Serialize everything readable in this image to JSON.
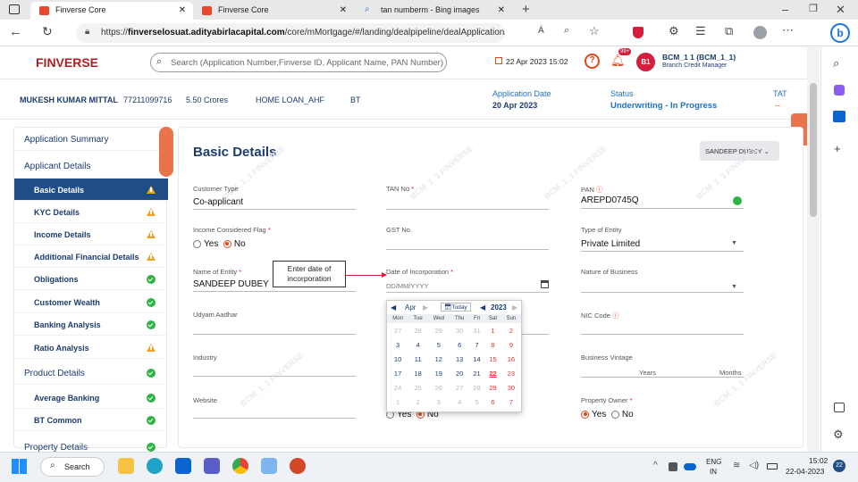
{
  "browser": {
    "tabs": [
      {
        "label": "Finverse Core"
      },
      {
        "label": "Finverse Core"
      },
      {
        "label": "tan numberm - Bing images"
      }
    ],
    "url_prefix": "https://",
    "url_host": "finverselosuat.adityabirlacapital.com",
    "url_path": "/core/mMortgage/#/landing/dealpipeline/dealApplication/perso...",
    "reader_label": "Á",
    "profile_icon": "profile-avatar"
  },
  "app": {
    "logo_text": "FINVERSE",
    "search_placeholder": "Search (Application Number,Finverse ID, Applicant Name, PAN Number)",
    "datetime": "22 Apr 2023 15:02",
    "notif_badge": "99+",
    "user_initials": "B1",
    "user_name": "BCM_1 1 (BCM_1_1)",
    "user_role": "Branch Credit Manager"
  },
  "infobar": {
    "name": "MUKESH KUMAR MITTAL",
    "phone": "77211099716",
    "amount": "5.50 Crores",
    "product": "HOME LOAN_AHF",
    "type": "BT",
    "app_date_label": "Application Date",
    "app_date": "20 Apr 2023",
    "status_label": "Status",
    "status": "Underwriting - In Progress",
    "tat_label": "TAT",
    "tat": "--"
  },
  "sidebar": {
    "sections": [
      {
        "label": "Application Summary"
      },
      {
        "label": "Applicant Details"
      }
    ],
    "items": [
      {
        "label": "Basic Details",
        "status": "warn"
      },
      {
        "label": "KYC Details",
        "status": "warn"
      },
      {
        "label": "Income Details",
        "status": "warn"
      },
      {
        "label": "Additional Financial Details",
        "status": "warn"
      },
      {
        "label": "Obligations",
        "status": "ok"
      },
      {
        "label": "Customer Wealth",
        "status": "ok"
      },
      {
        "label": "Banking Analysis",
        "status": "ok"
      },
      {
        "label": "Ratio Analysis",
        "status": "warn"
      }
    ],
    "product_section": "Product Details",
    "product_items": [
      {
        "label": "Average Banking",
        "status": "ok"
      },
      {
        "label": "BT Common",
        "status": "ok"
      }
    ],
    "property_section": "Property Details"
  },
  "form": {
    "title": "Basic Details",
    "user_dropdown": "SANDEEP DUBEY",
    "customer_type_label": "Customer Type",
    "customer_type": "Co-applicant",
    "tan_label": "TAN No",
    "pan_label": "PAN",
    "pan": "AREPD0745Q",
    "income_flag_label": "Income Considered Flag",
    "yes": "Yes",
    "no": "No",
    "gst_label": "GST No.",
    "entity_type_label": "Type of Entity",
    "entity_type": "Private Limited",
    "entity_name_label": "Name of Entity",
    "entity_name": "SANDEEP DUBEY",
    "doi_label": "Date of Incorporation",
    "doi_placeholder": "DD/MM/YYYY",
    "nature_label": "Nature of Business",
    "udyam_label": "Udyam Aadhar",
    "nic_label": "NIC Code",
    "industry_label": "Industry",
    "vintage_label": "Business Vintage",
    "years": "Years",
    "months": "Months",
    "website_label": "Website",
    "owner_label": "Property Owner",
    "callout": "Enter date of incorporation",
    "watermark": "BCM_1_1 FINVERSE"
  },
  "calendar": {
    "month": "Apr",
    "today": "Today",
    "year": "2023",
    "days": [
      "Mon",
      "Tue",
      "Wed",
      "Thu",
      "Fri",
      "Sat",
      "Sun"
    ],
    "weeks": [
      [
        "27",
        "28",
        "29",
        "30",
        "31",
        "1",
        "2"
      ],
      [
        "3",
        "4",
        "5",
        "6",
        "7",
        "8",
        "9"
      ],
      [
        "10",
        "11",
        "12",
        "13",
        "14",
        "15",
        "16"
      ],
      [
        "17",
        "18",
        "19",
        "20",
        "21",
        "22",
        "23"
      ],
      [
        "24",
        "25",
        "26",
        "27",
        "28",
        "29",
        "30"
      ],
      [
        "1",
        "2",
        "3",
        "4",
        "5",
        "6",
        "7"
      ]
    ]
  },
  "taskbar": {
    "search": "Search",
    "lang": "ENG",
    "region": "IN",
    "time": "15:02",
    "date": "22-04-2023",
    "badge": "22"
  },
  "colors": {
    "brand": "#b01e22",
    "navy": "#1f4e86",
    "accent": "#e2481d",
    "ok": "#2fb344",
    "warn": "#f0a020"
  }
}
